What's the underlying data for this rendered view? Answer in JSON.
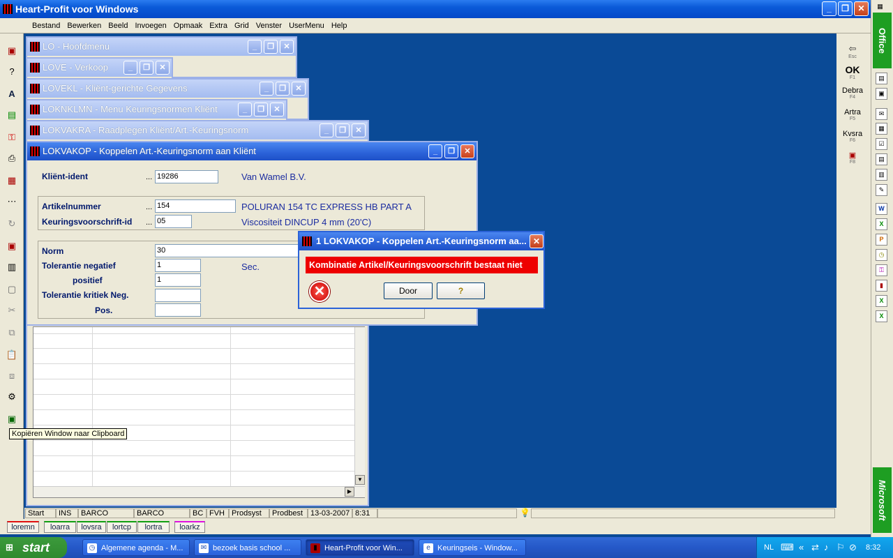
{
  "app": {
    "title": "Heart-Profit voor Windows",
    "min_glyph": "_",
    "restore_glyph": "❐",
    "close_glyph": "✕"
  },
  "menu": [
    "Bestand",
    "Bewerken",
    "Beeld",
    "Invoegen",
    "Opmaak",
    "Extra",
    "Grid",
    "Venster",
    "UserMenu",
    "Help"
  ],
  "windows": {
    "lo": "LO - Hoofdmenu",
    "love": "LOVE - Verkoop",
    "lovekl": "LOVEKL - Kliënt-gerichte Gegevens",
    "loknklmn": "LOKNKLMN - Menu Keuringsnormen Kliënt",
    "lokvakra": "LOKVAKRA - Raadplegen Kliënt/Art.-Keuringsnorm",
    "lokvakop": "LOKVAKOP - Koppelen Art.-Keuringsnorm aan Kliënt"
  },
  "form": {
    "klient_label": "Kliënt-ident",
    "klient_value": "19286",
    "klient_name": "Van Wamel B.V.",
    "artikel_label": "Artikelnummer",
    "artikel_value": "154",
    "artikel_desc": "POLURAN 154 TC EXPRESS HB PART A",
    "keur_label": "Keuringsvoorschrift-id",
    "keur_value": "05",
    "keur_desc": "Viscositeit DINCUP 4 mm (20'C)",
    "norm_label": "Norm",
    "norm_value": "30",
    "tol_neg_label": "Tolerantie negatief",
    "tol_neg_value": "1",
    "unit": "Sec.",
    "pos_label": "positief",
    "pos_value": "1",
    "tol_krit_label": "Tolerantie kritiek Neg.",
    "krit_pos_label": "Pos.",
    "dots": "..."
  },
  "dialog": {
    "title": "1 LOKVAKOP - Koppelen Art.-Keuringsnorm aa...",
    "message": "Kombinatie Artikel/Keuringsvoorschrift bestaat niet",
    "ok": "Door",
    "help": "?",
    "error_glyph": "✕"
  },
  "tooltip": "Kopiëren Window naar Clipboard",
  "right_toolbar": [
    {
      "label": "",
      "key": "Esc"
    },
    {
      "label": "OK",
      "key": "F1"
    },
    {
      "label": "Debra",
      "key": "F4"
    },
    {
      "label": "Artra",
      "key": "F5"
    },
    {
      "label": "Kvsra",
      "key": "F6"
    },
    {
      "label": "",
      "key": "F8"
    }
  ],
  "office": {
    "top": "Office",
    "bottom": "Microsoft"
  },
  "status": [
    "Start",
    "INS",
    "BARCO",
    "BARCO",
    "BC",
    "FVH",
    "Prodsyst",
    "Prodbest",
    "13-03-2007",
    "8:31"
  ],
  "bottom_tabs": [
    {
      "label": "loremn",
      "color": "#e01010"
    },
    {
      "label": "loarra",
      "color": "#10a010"
    },
    {
      "label": "lovsra",
      "color": "#10a010"
    },
    {
      "label": "lortcp",
      "color": "#10a010"
    },
    {
      "label": "lortra",
      "color": "#10a010"
    },
    {
      "label": "loarkz",
      "color": "#e010e0"
    }
  ],
  "taskbar": {
    "start": "start",
    "items": [
      "Algemene agenda - M...",
      "bezoek basis school ...",
      "Heart-Profit voor Win...",
      "Keuringseis - Window..."
    ],
    "lang": "NL",
    "time": "8:32"
  }
}
